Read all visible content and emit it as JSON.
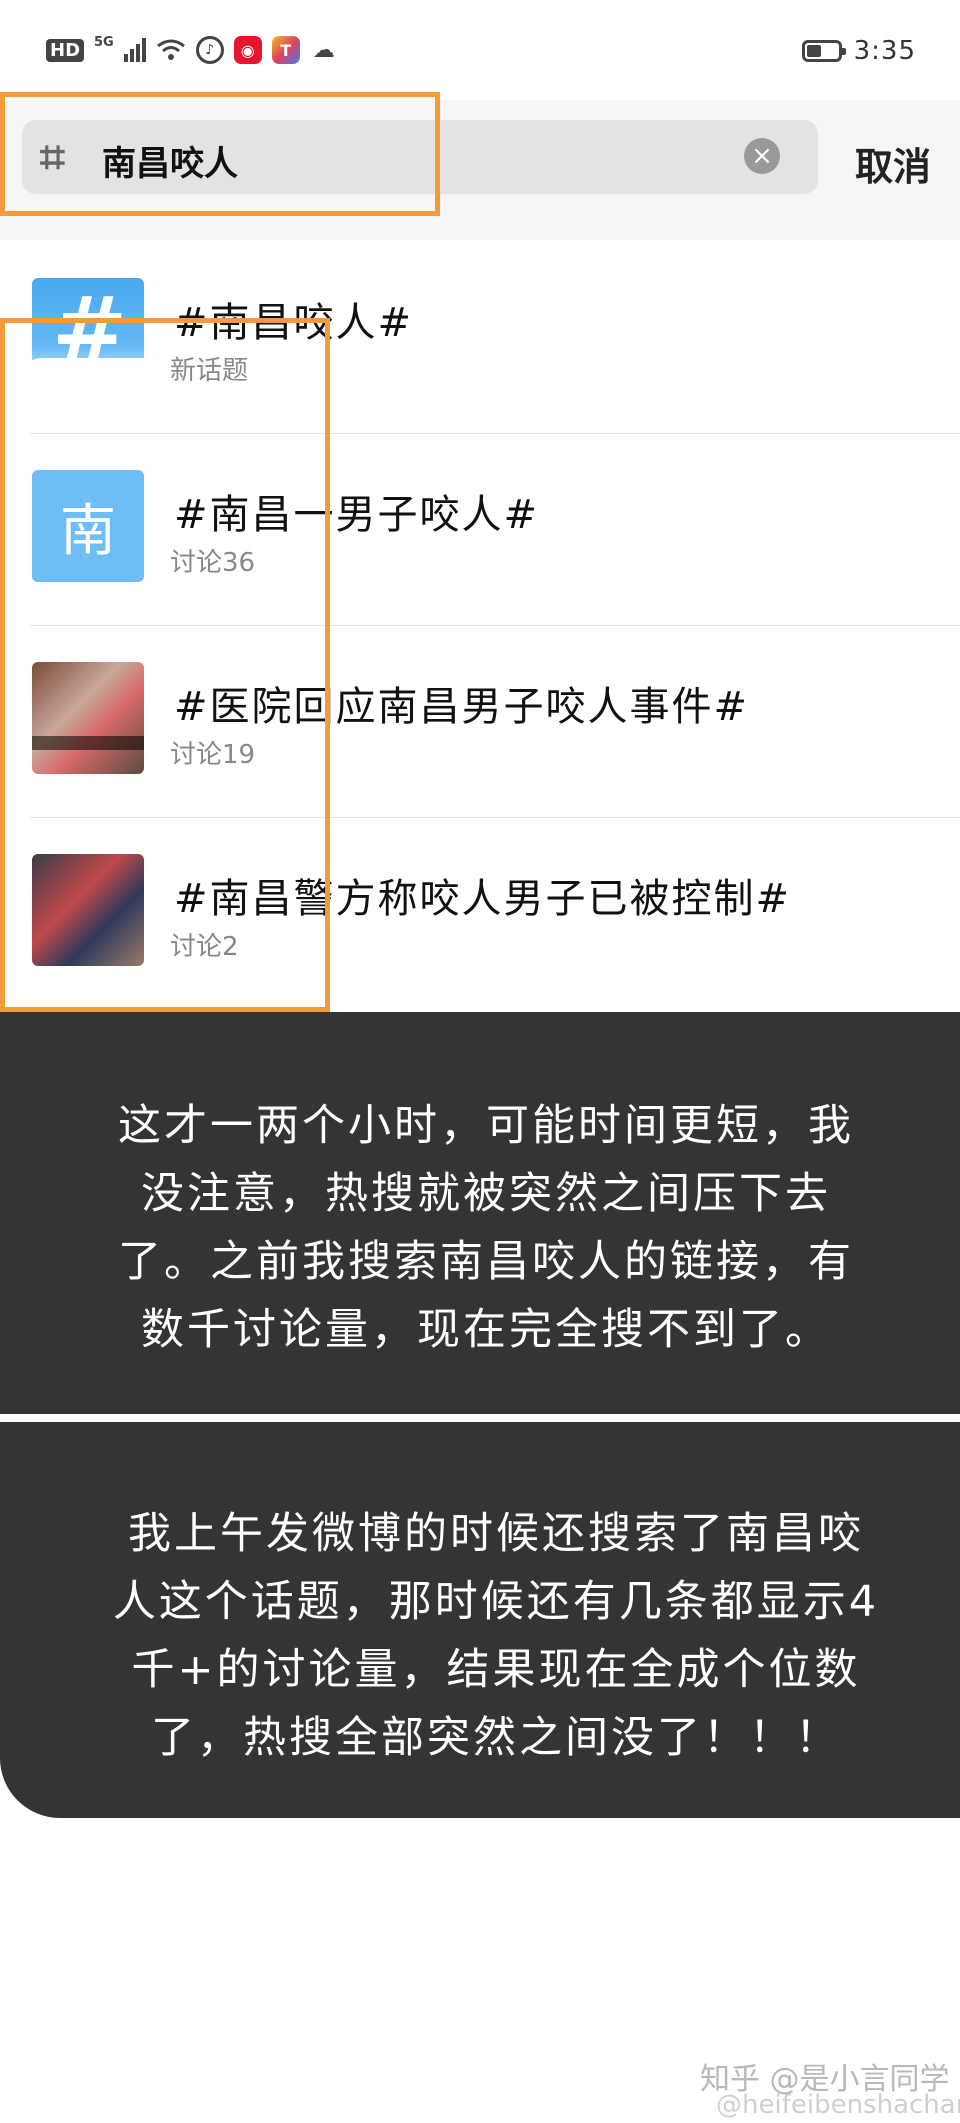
{
  "status_bar": {
    "hd": "HD",
    "network": "5G",
    "time": "3:35",
    "app_icons": [
      "netease-music-icon",
      "weibo-icon",
      "toutiao-icon",
      "wechat-icon"
    ]
  },
  "search": {
    "value": "南昌咬人",
    "cancel_label": "取消"
  },
  "results": [
    {
      "title": "#南昌咬人#",
      "subtitle": "新话题",
      "thumb": "new-topic-hash-icon"
    },
    {
      "title": "#南昌一男子咬人#",
      "subtitle": "讨论36",
      "thumb": "nan-char-avatar",
      "thumb_char": "南"
    },
    {
      "title": "#医院回应南昌男子咬人事件#",
      "subtitle": "讨论19",
      "thumb": "news-photo-thumbnail"
    },
    {
      "title": "#南昌警方称咬人男子已被控制#",
      "subtitle": "讨论2",
      "thumb": "police-photo-thumbnail"
    }
  ],
  "notes": {
    "note1_lines": [
      "这才一两个小时，可能时间更短，我",
      "没注意，热搜就被突然之间压下去",
      "了。之前我搜索南昌咬人的链接，有",
      "数千讨论量，现在完全搜不到了。"
    ],
    "note2_lines": [
      "我上午发微博的时候还搜索了南昌咬",
      "人这个话题，那时候还有几条都显示4",
      "千+的讨论量，结果现在全成个位数",
      "了，热搜全部突然之间没了！！！"
    ]
  },
  "watermark": {
    "zhihu": "知乎 @是小言同学",
    "weibo": "@heifeibenshachar"
  },
  "colors": {
    "highlight": "#f39b3a",
    "panel": "#343434"
  }
}
